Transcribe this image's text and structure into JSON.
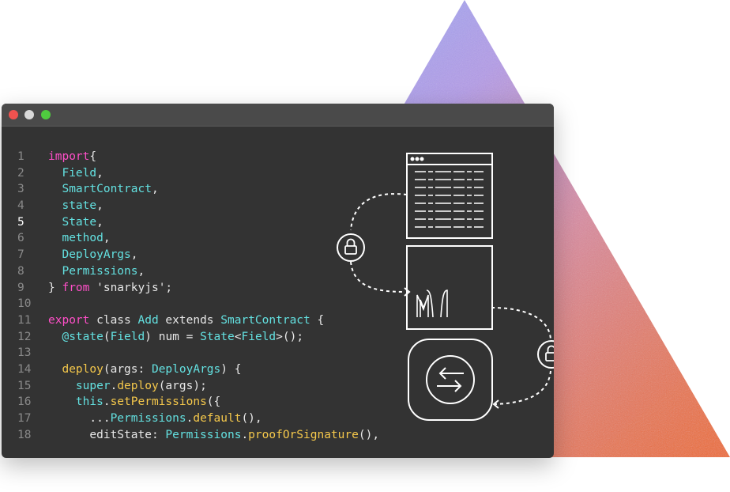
{
  "window": {
    "traffic_lights": [
      "close",
      "minimize",
      "maximize"
    ]
  },
  "code": {
    "lines": [
      {
        "n": "1",
        "tokens": [
          [
            "kw",
            "import"
          ],
          [
            "",
            "{ "
          ]
        ]
      },
      {
        "n": "2",
        "tokens": [
          [
            "",
            "  "
          ],
          [
            "ty",
            "Field"
          ],
          [
            "",
            ","
          ]
        ]
      },
      {
        "n": "3",
        "tokens": [
          [
            "",
            "  "
          ],
          [
            "ty",
            "SmartContract"
          ],
          [
            "",
            ","
          ]
        ]
      },
      {
        "n": "4",
        "tokens": [
          [
            "",
            "  "
          ],
          [
            "ty",
            "state"
          ],
          [
            "",
            ","
          ]
        ]
      },
      {
        "n": "5",
        "tokens": [
          [
            "",
            "  "
          ],
          [
            "ty",
            "State"
          ],
          [
            "",
            ","
          ]
        ]
      },
      {
        "n": "6",
        "tokens": [
          [
            "",
            "  "
          ],
          [
            "ty",
            "method"
          ],
          [
            "",
            ","
          ]
        ]
      },
      {
        "n": "7",
        "tokens": [
          [
            "",
            "  "
          ],
          [
            "ty",
            "DeployArgs"
          ],
          [
            "",
            ","
          ]
        ]
      },
      {
        "n": "8",
        "tokens": [
          [
            "",
            "  "
          ],
          [
            "ty",
            "Permissions"
          ],
          [
            "",
            ","
          ]
        ]
      },
      {
        "n": "9",
        "tokens": [
          [
            "",
            "} "
          ],
          [
            "kw",
            "from"
          ],
          [
            "str",
            " 'snarkyjs'"
          ],
          [
            "",
            ";"
          ]
        ]
      },
      {
        "n": "10",
        "tokens": []
      },
      {
        "n": "11",
        "tokens": [
          [
            "kw",
            "export"
          ],
          [
            "",
            " class "
          ],
          [
            "ty",
            "Add"
          ],
          [
            "",
            " extends "
          ],
          [
            "ty",
            "SmartContract"
          ],
          [
            "",
            " {"
          ]
        ]
      },
      {
        "n": "12",
        "tokens": [
          [
            "",
            "  "
          ],
          [
            "ty",
            "@state"
          ],
          [
            "",
            "("
          ],
          [
            "ty",
            "Field"
          ],
          [
            "",
            ") num = "
          ],
          [
            "ty",
            "State"
          ],
          [
            "",
            "<"
          ],
          [
            "ty",
            "Field"
          ],
          [
            "",
            ">();"
          ]
        ]
      },
      {
        "n": "13",
        "tokens": []
      },
      {
        "n": "14",
        "tokens": [
          [
            "",
            "  "
          ],
          [
            "fn",
            "deploy"
          ],
          [
            "",
            "(args: "
          ],
          [
            "ty",
            "DeployArgs"
          ],
          [
            "",
            ") {"
          ]
        ]
      },
      {
        "n": "15",
        "tokens": [
          [
            "",
            "    "
          ],
          [
            "ty",
            "super"
          ],
          [
            "",
            "."
          ],
          [
            "fn",
            "deploy"
          ],
          [
            "",
            "(args);"
          ]
        ]
      },
      {
        "n": "16",
        "tokens": [
          [
            "",
            "    "
          ],
          [
            "ty",
            "this"
          ],
          [
            "",
            "."
          ],
          [
            "fn",
            "setPermissions"
          ],
          [
            "",
            "({"
          ]
        ]
      },
      {
        "n": "17",
        "tokens": [
          [
            "",
            "      ..."
          ],
          [
            "ty",
            "Permissions"
          ],
          [
            "",
            "."
          ],
          [
            "fn",
            "default"
          ],
          [
            "",
            "(),"
          ]
        ]
      },
      {
        "n": "18",
        "tokens": [
          [
            "",
            "      editState: "
          ],
          [
            "ty",
            "Permissions"
          ],
          [
            "",
            "."
          ],
          [
            "fn",
            "proofOrSignature"
          ],
          [
            "",
            "(),"
          ]
        ]
      }
    ],
    "active_line": "5"
  },
  "diagram": {
    "icons": [
      "document-icon",
      "lock-icon",
      "mina-logo-icon",
      "lock-icon",
      "swap-arrows-icon"
    ]
  },
  "colors": {
    "keyword": "#ff4fc8",
    "type": "#63e0e0",
    "function": "#f5c84b",
    "editor_bg": "#333333"
  }
}
